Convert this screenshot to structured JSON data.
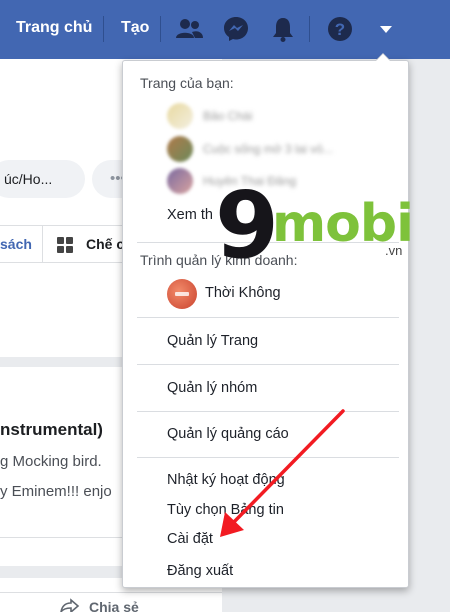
{
  "topbar": {
    "home_label": "Trang chủ",
    "create_label": "Tạo",
    "icons": [
      "friends-icon",
      "messenger-icon",
      "notifications-icon",
      "help-icon",
      "dropdown-caret-icon"
    ],
    "bg_color": "#4267b2"
  },
  "background_page": {
    "search_pill_text": "úc/Ho...",
    "more_pill_text": "•••",
    "tab_left_label": "sách",
    "tab_right_label": "Chế c",
    "post_title": "nstrumental)",
    "post_line1": "g Mocking bird.",
    "post_line2": "y Eminem!!! enjo",
    "share_label": "Chia sẻ"
  },
  "menu": {
    "pages_heading": "Trang của bạn:",
    "blurred_pages": [
      "Bảo Chài",
      "Cuộc sống mở 3 lai vỏ...",
      "Huyên Thai Đăng"
    ],
    "see_more_label": "Xem th",
    "business_heading": "Trình quản lý kinh doanh:",
    "business_account": "Thời Không",
    "manage_pages": "Quản lý Trang",
    "manage_groups": "Quản lý nhóm",
    "manage_ads": "Quản lý quảng cáo",
    "activity_log": "Nhật ký hoạt động",
    "news_feed_prefs_a": "Tùy chọn ",
    "news_feed_prefs_b": "Bảng tin",
    "settings": "Cài đặt",
    "logout": "Đăng xuất"
  },
  "watermark": {
    "nine": "9",
    "mobi": "mobi",
    "vn": ".vn"
  },
  "colors": {
    "accent_red": "#f21b22",
    "watermark_green": "#7ec23b"
  }
}
